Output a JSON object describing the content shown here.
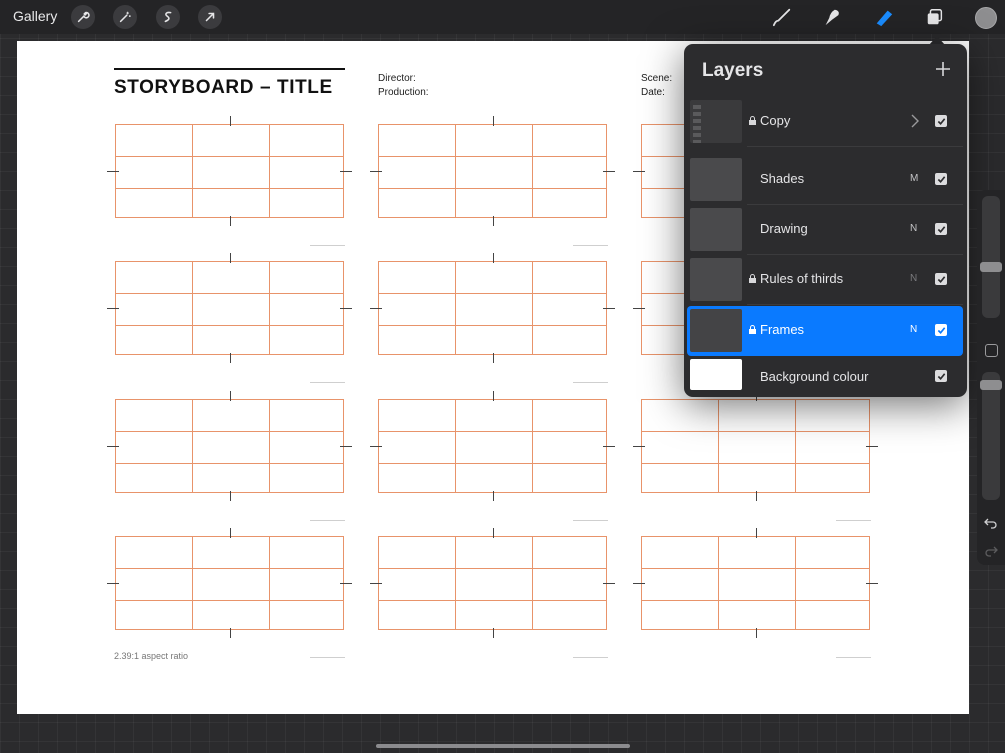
{
  "toolbar": {
    "gallery_label": "Gallery",
    "left_tools": [
      "wrench-icon",
      "magic-wand-icon",
      "selection-icon",
      "transform-arrow-icon"
    ],
    "right_tools": [
      "brush-icon",
      "smudge-icon",
      "eraser-icon",
      "layers-icon"
    ],
    "active_tool": "eraser-icon",
    "accent_color": "#1a8cff",
    "current_color": "#8e8e90"
  },
  "canvas": {
    "title": "STORYBOARD – TITLE",
    "director_label": "Director:",
    "production_label": "Production:",
    "scene_label": "Scene:",
    "date_label": "Date:",
    "aspect_note": "2.39:1 aspect ratio",
    "frame_color": "#e8936a",
    "frame_grid": "4 rows x 3 columns, rule-of-thirds lines in each frame"
  },
  "layers_panel": {
    "title": "Layers",
    "add_icon": "plus-icon",
    "layers": [
      {
        "name": "Copy",
        "locked": true,
        "blend": "",
        "visible": true,
        "group": true,
        "selected": false
      },
      {
        "name": "Shades",
        "locked": false,
        "blend": "M",
        "visible": true,
        "group": false,
        "selected": false
      },
      {
        "name": "Drawing",
        "locked": false,
        "blend": "N",
        "visible": true,
        "group": false,
        "selected": false
      },
      {
        "name": "Rules of thirds",
        "locked": true,
        "blend": "N",
        "visible": true,
        "group": false,
        "selected": false
      },
      {
        "name": "Frames",
        "locked": true,
        "blend": "N",
        "visible": true,
        "group": false,
        "selected": true
      },
      {
        "name": "Background colour",
        "locked": false,
        "blend": "",
        "visible": true,
        "group": false,
        "selected": false
      }
    ],
    "selected_color": "#0a7aff"
  }
}
